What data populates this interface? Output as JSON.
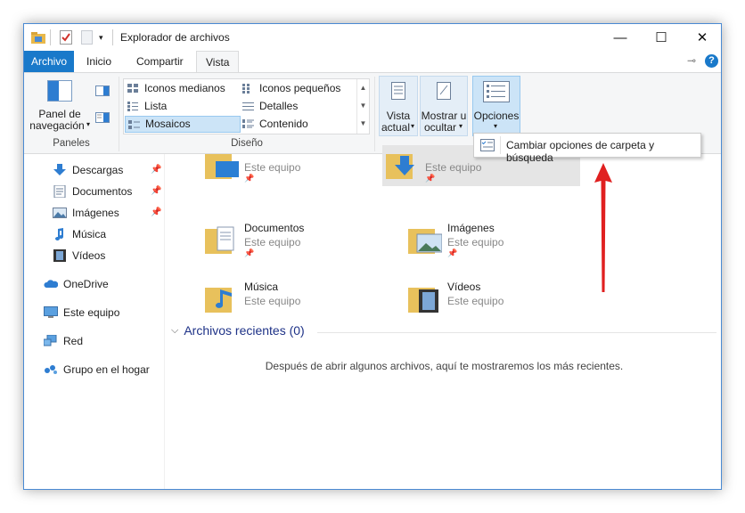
{
  "window": {
    "title": "Explorador de archivos"
  },
  "controls": {
    "minimize": "—",
    "maximize": "☐",
    "close": "✕",
    "help": "?",
    "pin": "⊸"
  },
  "tabs": [
    {
      "label": "Archivo"
    },
    {
      "label": "Inicio"
    },
    {
      "label": "Compartir"
    },
    {
      "label": "Vista"
    }
  ],
  "ribbon": {
    "panes": {
      "nav_pane_line1": "Panel de",
      "nav_pane_line2": "navegación",
      "group_label": "Paneles"
    },
    "layout": {
      "items": [
        {
          "label": "Iconos medianos"
        },
        {
          "label": "Iconos pequeños"
        },
        {
          "label": "Lista"
        },
        {
          "label": "Detalles"
        },
        {
          "label": "Mosaicos"
        },
        {
          "label": "Contenido"
        }
      ],
      "selected": "Mosaicos",
      "group_label": "Diseño"
    },
    "current_view": {
      "line1": "Vista",
      "line2": "actual"
    },
    "show_hide": {
      "line1": "Mostrar u",
      "line2": "ocultar"
    },
    "options": {
      "label": "Opciones"
    }
  },
  "options_menu": {
    "item": "Cambiar opciones de carpeta y búsqueda"
  },
  "sidebar": {
    "quick_items": [
      {
        "label": "Descargas",
        "pinned": true
      },
      {
        "label": "Documentos",
        "pinned": true
      },
      {
        "label": "Imágenes",
        "pinned": true
      },
      {
        "label": "Música",
        "pinned": false
      },
      {
        "label": "Vídeos",
        "pinned": false
      }
    ],
    "onedrive": "OneDrive",
    "this_pc": "Este equipo",
    "network": "Red",
    "homegroup": "Grupo en el hogar"
  },
  "folders": [
    {
      "name": "",
      "location": "Este equipo"
    },
    {
      "name": "",
      "location": "Este equipo"
    },
    {
      "name": "Documentos",
      "location": "Este equipo"
    },
    {
      "name": "Imágenes",
      "location": "Este equipo"
    },
    {
      "name": "Música",
      "location": "Este equipo"
    },
    {
      "name": "Vídeos",
      "location": "Este equipo"
    }
  ],
  "recent": {
    "header": "Archivos recientes (0)",
    "empty_message": "Después de abrir algunos archivos, aquí te mostraremos los más recientes."
  },
  "colors": {
    "accent": "#1979ca",
    "selection": "#cce4f7",
    "arrow": "#e02020"
  }
}
